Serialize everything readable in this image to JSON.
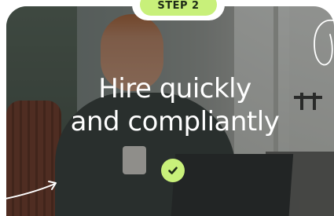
{
  "step": {
    "label": "STEP 2"
  },
  "hero": {
    "headline_line1": "Hire quickly",
    "headline_line2": "and compliantly"
  },
  "icons": {
    "check": "check-icon",
    "arrow": "curved-arrow-icon",
    "loop": "loop-doodle-icon"
  },
  "colors": {
    "accent": "#c8f07a",
    "badge_border": "#ffffff",
    "headline": "#ffffff"
  }
}
